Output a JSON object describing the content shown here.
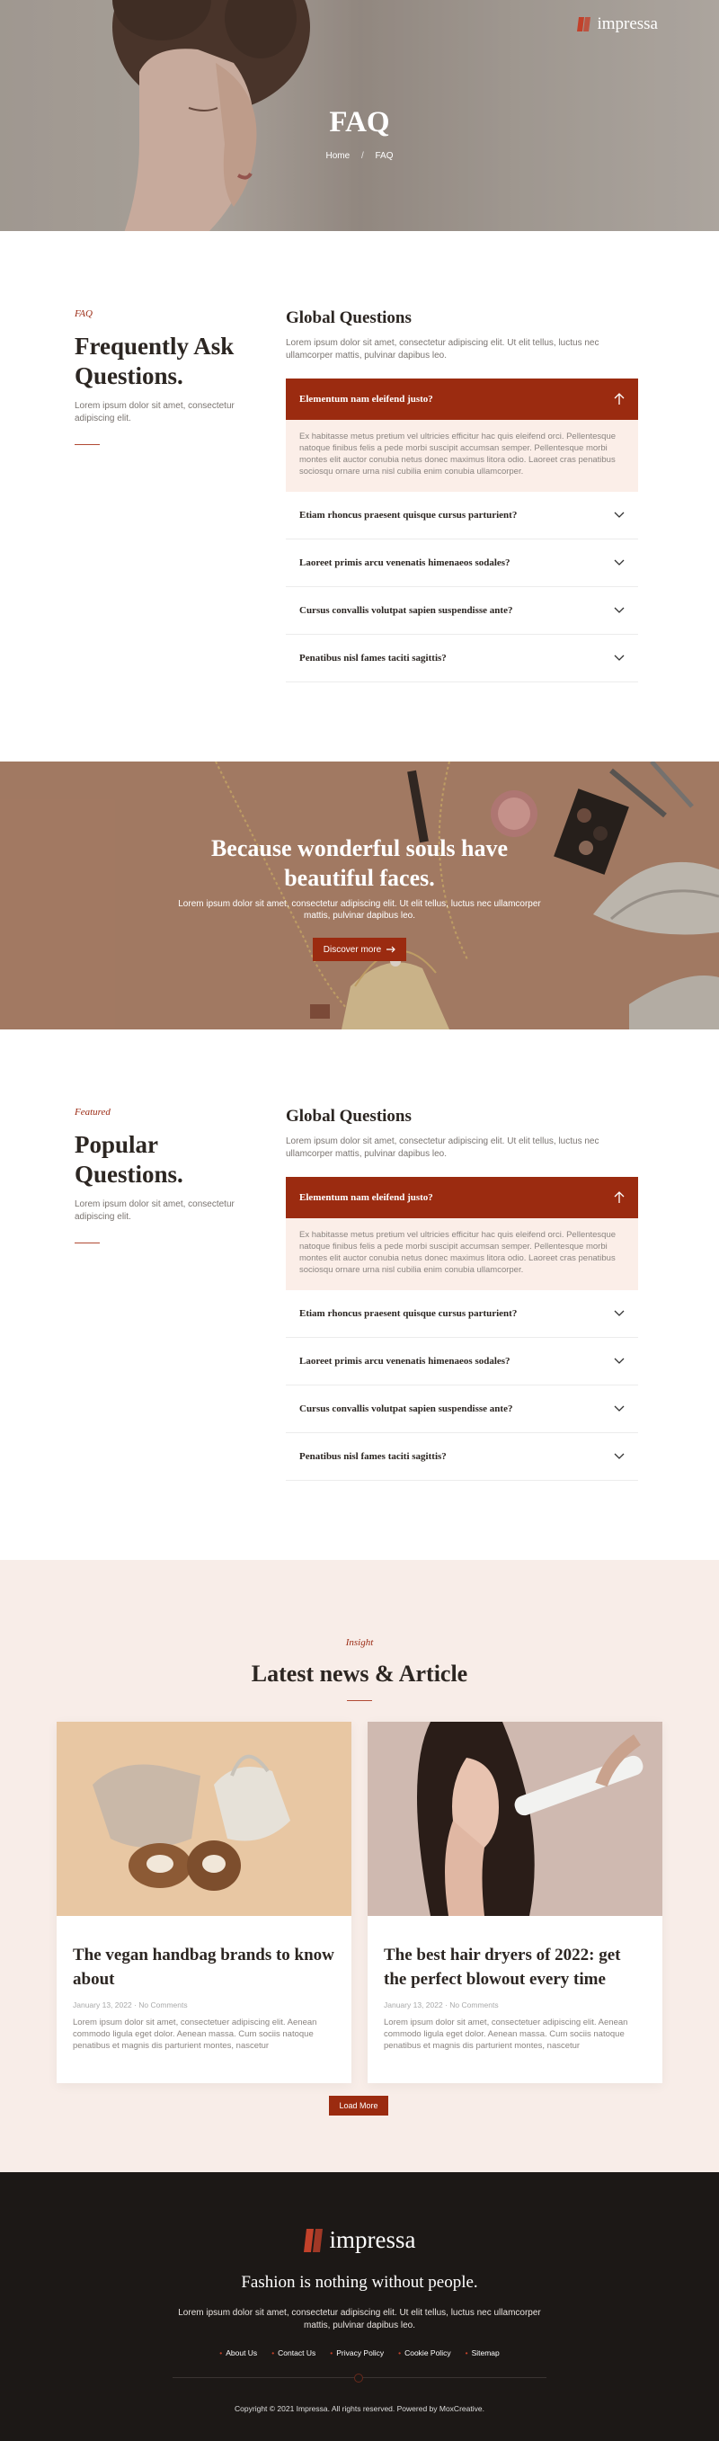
{
  "brand": {
    "name": "impressa",
    "color": "#9b2b10"
  },
  "hero": {
    "title": "FAQ",
    "breadcrumb": {
      "home": "Home",
      "separator": "/",
      "current": "FAQ"
    }
  },
  "faq1": {
    "eyebrow": "FAQ",
    "title": "Frequently Ask Questions.",
    "text": "Lorem ipsum dolor sit amet, consectetur adipiscing elit.",
    "panel_title": "Global Questions",
    "panel_desc": "Lorem ipsum dolor sit amet, consectetur adipiscing elit. Ut elit tellus, luctus nec ullamcorper mattis, pulvinar dapibus leo.",
    "open": {
      "question": "Elementum nam eleifend justo?",
      "answer": "Ex habitasse metus pretium vel ultricies efficitur hac quis eleifend orci. Pellentesque natoque finibus felis a pede morbi suscipit accumsan semper. Pellentesque morbi montes elit auctor conubia netus donec maximus litora odio. Laoreet cras penatibus sociosqu ornare urna nisl cubilia enim conubia ullamcorper."
    },
    "items": [
      "Etiam rhoncus praesent quisque cursus parturient?",
      "Laoreet primis arcu venenatis himenaeos sodales?",
      "Cursus convallis volutpat sapien suspendisse ante?",
      "Penatibus nisl fames taciti sagittis?"
    ]
  },
  "banner": {
    "title": "Because wonderful souls have beautiful faces.",
    "text": "Lorem ipsum dolor sit amet, consectetur adipiscing elit. Ut elit tellus, luctus nec ullamcorper mattis, pulvinar dapibus leo.",
    "button": "Discover more"
  },
  "faq2": {
    "eyebrow": "Featured",
    "title": "Popular Questions.",
    "text": "Lorem ipsum dolor sit amet, consectetur adipiscing elit.",
    "panel_title": "Global Questions",
    "panel_desc": "Lorem ipsum dolor sit amet, consectetur adipiscing elit. Ut elit tellus, luctus nec ullamcorper mattis, pulvinar dapibus leo.",
    "open": {
      "question": "Elementum nam eleifend justo?",
      "answer": "Ex habitasse metus pretium vel ultricies efficitur hac quis eleifend orci. Pellentesque natoque finibus felis a pede morbi suscipit accumsan semper. Pellentesque morbi montes elit auctor conubia netus donec maximus litora odio. Laoreet cras penatibus sociosqu ornare urna nisl cubilia enim conubia ullamcorper."
    },
    "items": [
      "Etiam rhoncus praesent quisque cursus parturient?",
      "Laoreet primis arcu venenatis himenaeos sodales?",
      "Cursus convallis volutpat sapien suspendisse ante?",
      "Penatibus nisl fames taciti sagittis?"
    ]
  },
  "news": {
    "eyebrow": "Insight",
    "title": "Latest news & Article",
    "posts": [
      {
        "title": "The vegan handbag brands to know about",
        "date": "January 13, 2022",
        "comments": "No Comments",
        "excerpt": "Lorem ipsum dolor sit amet, consectetuer adipiscing elit. Aenean commodo ligula eget dolor. Aenean massa. Cum sociis natoque penatibus et magnis dis parturient montes, nascetur"
      },
      {
        "title": "The best hair dryers of 2022: get the perfect blowout every time",
        "date": "January 13, 2022",
        "comments": "No Comments",
        "excerpt": "Lorem ipsum dolor sit amet, consectetuer adipiscing elit. Aenean commodo ligula eget dolor. Aenean massa. Cum sociis natoque penatibus et magnis dis parturient montes, nascetur"
      }
    ],
    "load_more": "Load More"
  },
  "footer": {
    "tagline": "Fashion is nothing without people.",
    "text": "Lorem ipsum dolor sit amet, consectetur adipiscing elit. Ut elit tellus, luctus nec ullamcorper mattis, pulvinar dapibus leo.",
    "links": [
      "About Us",
      "Contact Us",
      "Privacy Policy",
      "Cookie Policy",
      "Sitemap"
    ],
    "copyright": "Copyright © 2021 Impressa. All rights reserved. Powered by MoxCreative."
  },
  "icons": {
    "logo": "impressa-logo-icon",
    "open": "arrow-up-icon",
    "closed": "chevron-down-icon",
    "button": "arrow-right-icon"
  }
}
